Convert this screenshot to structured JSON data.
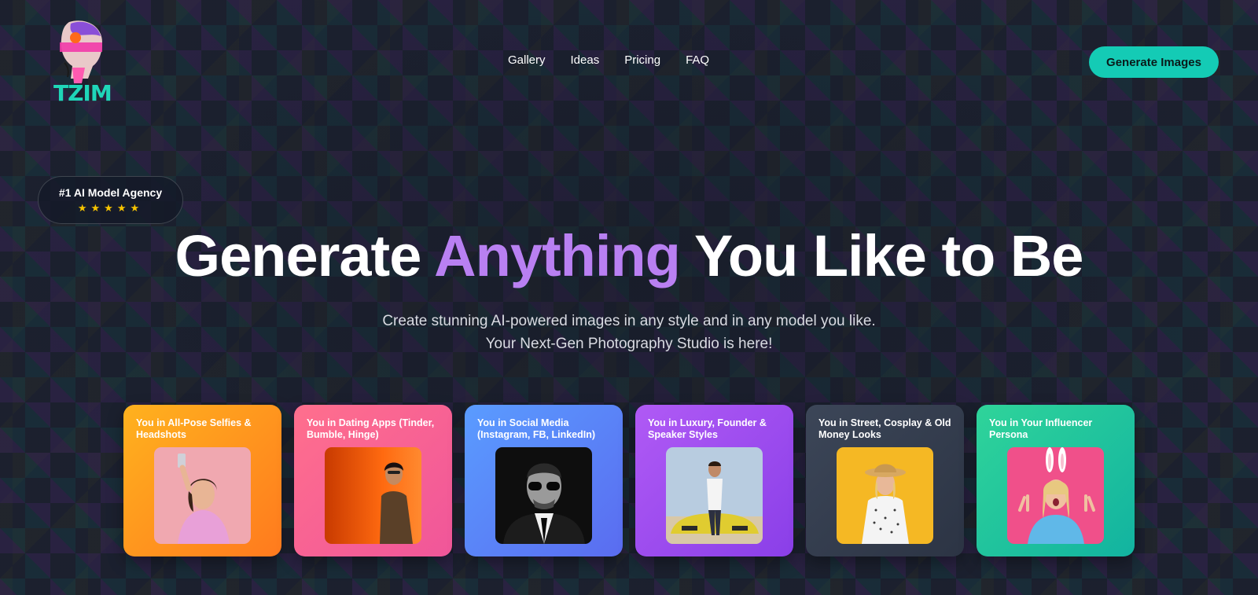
{
  "brand": {
    "logo_text": "TZIM",
    "logo_icon": "sculpture-head-icon"
  },
  "nav": {
    "items": [
      "Gallery",
      "Ideas",
      "Pricing",
      "FAQ"
    ]
  },
  "header": {
    "cta_label": "Generate Images"
  },
  "badge": {
    "title": "#1 AI Model Agency",
    "stars": "★★★★★",
    "rating": 5
  },
  "hero": {
    "headline_part1": "Generate ",
    "headline_accent": "Anything",
    "headline_part2": " You Like to Be",
    "subline1": "Create stunning AI-powered images in any style and in any model you like.",
    "subline2": "Your Next-Gen Photography Studio is here!"
  },
  "cards": [
    {
      "label": "You in All-Pose Selfies & Headshots",
      "gradient": [
        "#ffb21e",
        "#ff7a1e"
      ],
      "photo": "selfie-woman"
    },
    {
      "label": "You in Dating Apps (Tinder, Bumble, Hinge)",
      "gradient": [
        "#ff6f8d",
        "#f0569a"
      ],
      "photo": "man-orange-backdrop"
    },
    {
      "label": "You in Social Media (Instagram, FB, LinkedIn)",
      "gradient": [
        "#5a9cff",
        "#5a6cf0"
      ],
      "photo": "man-sunglasses-bw"
    },
    {
      "label": "You in Luxury, Founder & Speaker Styles",
      "gradient": [
        "#b05af5",
        "#8a3fe8"
      ],
      "photo": "man-sports-car"
    },
    {
      "label": "You in Street, Cosplay & Old Money Looks",
      "gradient": [
        "#3c4658",
        "#2c3444"
      ],
      "photo": "woman-straw-hat"
    },
    {
      "label": "You in Your Influencer Persona",
      "gradient": [
        "#2fd49a",
        "#12b3a0"
      ],
      "photo": "woman-bunny-ears"
    }
  ],
  "colors": {
    "accent": "#b980f2",
    "cta": "#14cbb5",
    "star": "#f7c400"
  }
}
